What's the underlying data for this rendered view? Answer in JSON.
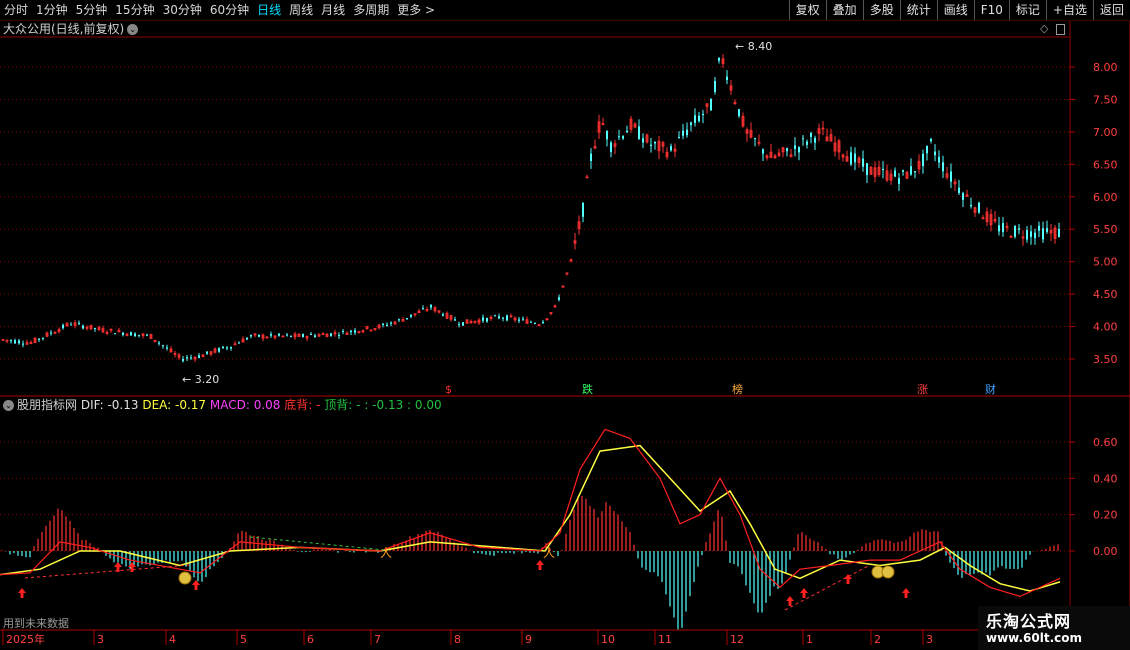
{
  "toolbar": {
    "periods": [
      "分时",
      "1分钟",
      "5分钟",
      "15分钟",
      "30分钟",
      "60分钟",
      "日线",
      "周线",
      "月线",
      "多周期",
      "更多"
    ],
    "more_arrow": ">",
    "right_buttons": [
      "复权",
      "叠加",
      "多股",
      "统计",
      "画线",
      "F10",
      "标记",
      "+自选",
      "返回"
    ]
  },
  "stock": {
    "title": "大众公用(日线,前复权)",
    "high_label": "8.40",
    "low_label": "3.20"
  },
  "price_axis": [
    "8.00",
    "7.50",
    "7.00",
    "6.50",
    "6.00",
    "5.50",
    "5.00",
    "4.50",
    "4.00",
    "3.50"
  ],
  "event_markers": [
    {
      "text": "$",
      "color": "#ff3030"
    },
    {
      "text": "跌",
      "color": "#30ff60"
    },
    {
      "text": "榜",
      "color": "#ffaa40"
    },
    {
      "text": "涨",
      "color": "#ff4040"
    },
    {
      "text": "财",
      "color": "#40a0ff"
    }
  ],
  "indicator": {
    "name": "股朋指标网",
    "dif_label": "DIF: -0.13",
    "dea_label": "DEA: -0.17",
    "macd_label": "MACD: 0.08",
    "bottom_div": "底背: -",
    "top_div": "顶背: -",
    "tail": ": -0.13 : 0.00"
  },
  "macd_axis": [
    "0.60",
    "0.40",
    "0.20",
    "0.00"
  ],
  "future_label": "用到未来数据",
  "date_axis": [
    "2025年",
    "3",
    "4",
    "5",
    "6",
    "7",
    "8",
    "9",
    "10",
    "11",
    "12",
    "1",
    "2",
    "3"
  ],
  "watermark": {
    "line1": "乐淘公式网",
    "line2": "www.60lt.com"
  },
  "colors": {
    "up": "#ff3232",
    "down": "#54ffff",
    "grid": "#8a0000",
    "dif": "#ff2020",
    "dea": "#ffff40"
  }
}
